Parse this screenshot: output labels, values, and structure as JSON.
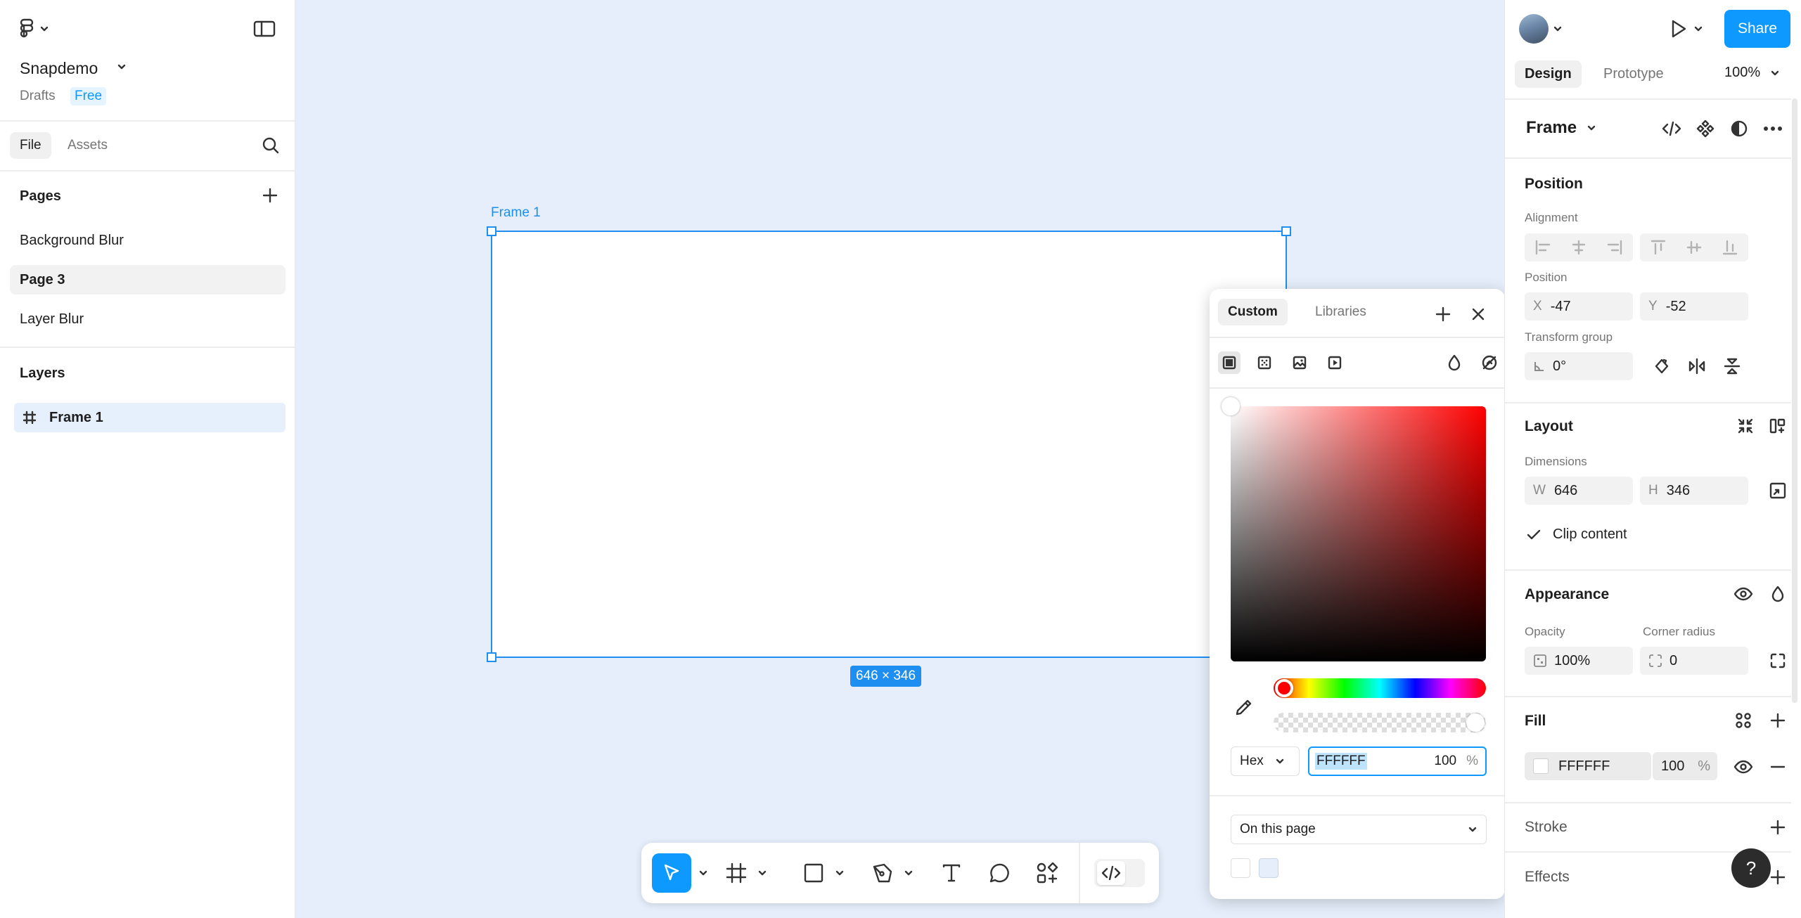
{
  "app": {
    "file_name": "Snapdemo",
    "location": "Drafts",
    "plan_badge": "Free"
  },
  "left_panel": {
    "tabs": [
      "File",
      "Assets"
    ],
    "pages_title": "Pages",
    "pages": [
      "Background Blur",
      "Page 3",
      "Layer Blur"
    ],
    "selected_page": "Page 3",
    "layers_title": "Layers",
    "layers": [
      "Frame 1"
    ]
  },
  "canvas": {
    "frame_label": "Frame 1",
    "size_badge": "646 × 346",
    "background": "#e5eefa",
    "selection_color": "#1e8ff1"
  },
  "toolbar": {
    "tools": [
      "move-tool",
      "frame-tool",
      "rectangle-tool",
      "pen-tool",
      "text-tool",
      "comment-tool",
      "actions-tool",
      "dev-mode-toggle"
    ]
  },
  "color_picker": {
    "tabs": [
      "Custom",
      "Libraries"
    ],
    "format": "Hex",
    "hex_value": "FFFFFF",
    "opacity": "100",
    "percent": "%",
    "swatch_scope": "On this page",
    "swatches": [
      "#ffffff",
      "#e5eefa"
    ],
    "hue_color": "#ff0000"
  },
  "right_panel": {
    "share_label": "Share",
    "tabs": [
      "Design",
      "Prototype"
    ],
    "zoom": "100%",
    "selection_type": "Frame",
    "position": {
      "title": "Position",
      "alignment_label": "Alignment",
      "position_label": "Position",
      "x_prefix": "X",
      "x": "-47",
      "y_prefix": "Y",
      "y": "-52",
      "transform_label": "Transform group",
      "rotation": "0°"
    },
    "layout": {
      "title": "Layout",
      "dimensions_label": "Dimensions",
      "w_prefix": "W",
      "w": "646",
      "h_prefix": "H",
      "h": "346",
      "clip_label": "Clip content",
      "clip_checked": true
    },
    "appearance": {
      "title": "Appearance",
      "opacity_label": "Opacity",
      "opacity": "100%",
      "radius_label": "Corner radius",
      "radius": "0"
    },
    "fill": {
      "title": "Fill",
      "hex": "FFFFFF",
      "opacity": "100",
      "percent": "%"
    },
    "stroke_title": "Stroke",
    "effects_title": "Effects",
    "help": "?"
  },
  "colors": {
    "accent": "#0d99ff",
    "selection": "#1e8ff1",
    "layer_highlight": "#e5f0fc"
  }
}
